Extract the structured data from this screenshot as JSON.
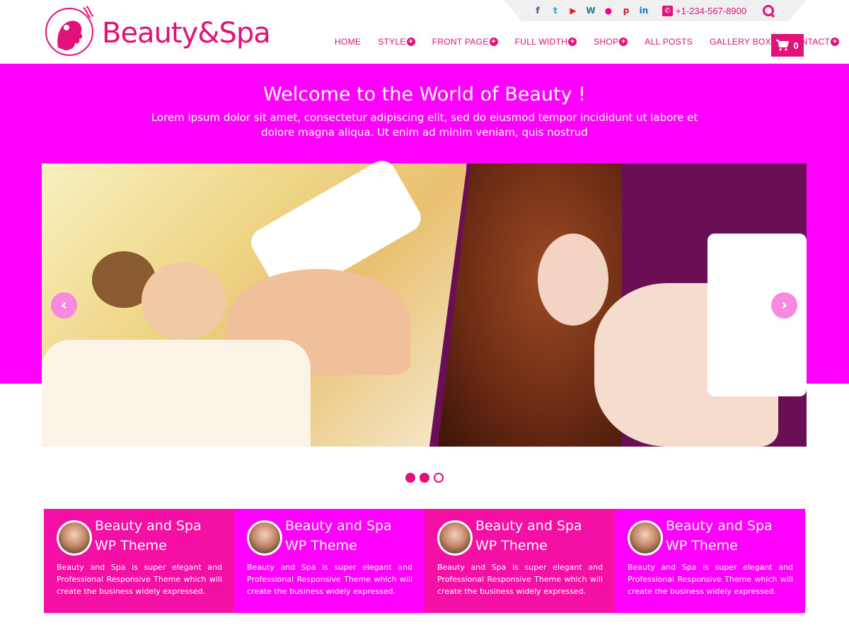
{
  "brand": {
    "logo_text": "Beauty&Spa",
    "accent_color": "#e0127a",
    "hero_color": "#ff00ff",
    "box_dark_color": "#f40fa5"
  },
  "topbar": {
    "social": [
      {
        "name": "facebook-icon",
        "glyph": "f"
      },
      {
        "name": "twitter-icon",
        "glyph": "t"
      },
      {
        "name": "youtube-icon",
        "glyph": "▶"
      },
      {
        "name": "wordpress-icon",
        "glyph": "W"
      },
      {
        "name": "flickr-icon",
        "glyph": "●"
      },
      {
        "name": "pinterest-icon",
        "glyph": "p"
      },
      {
        "name": "linkedin-icon",
        "glyph": "in"
      }
    ],
    "phone": "+1-234-567-8900"
  },
  "nav": {
    "items": [
      {
        "label": "HOME",
        "has_submenu": false
      },
      {
        "label": "STYLE",
        "has_submenu": true
      },
      {
        "label": "FRONT PAGE",
        "has_submenu": true
      },
      {
        "label": "FULL WIDTH",
        "has_submenu": true
      },
      {
        "label": "SHOP",
        "has_submenu": true
      },
      {
        "label": "ALL POSTS",
        "has_submenu": false
      },
      {
        "label": "GALLERY BOX",
        "has_submenu": false
      },
      {
        "label": "CONTACT",
        "has_submenu": true
      }
    ],
    "cart_count": "0"
  },
  "hero": {
    "title": "Welcome to the World of Beauty !",
    "subtitle": "Lorem ipsum dolor sit amet, consectetur adipiscing elit, sed do eiusmod tempor incididunt ut labore et dolore magna aliqua. Ut enim ad minim veniam, quis nostrud"
  },
  "slider": {
    "prev_label": "‹",
    "next_label": "›",
    "dot_count": 3,
    "active_dot": 3
  },
  "features": [
    {
      "title": "Beauty and Spa WP Theme",
      "text": "Beauty and Spa is super elegant and Professional Responsive Theme which will create the business widely expressed."
    },
    {
      "title": "Beauty and Spa WP Theme",
      "text": "Beauty and Spa is super elegant and Professional Responsive Theme which will create the business widely expressed."
    },
    {
      "title": "Beauty and Spa WP Theme",
      "text": "Beauty and Spa is super elegant and Professional Responsive Theme which will create the business widely expressed."
    },
    {
      "title": "Beauty and Spa WP Theme",
      "text": "Beauty and Spa is super elegant and Professional Responsive Theme which will create the business widely expressed."
    }
  ]
}
